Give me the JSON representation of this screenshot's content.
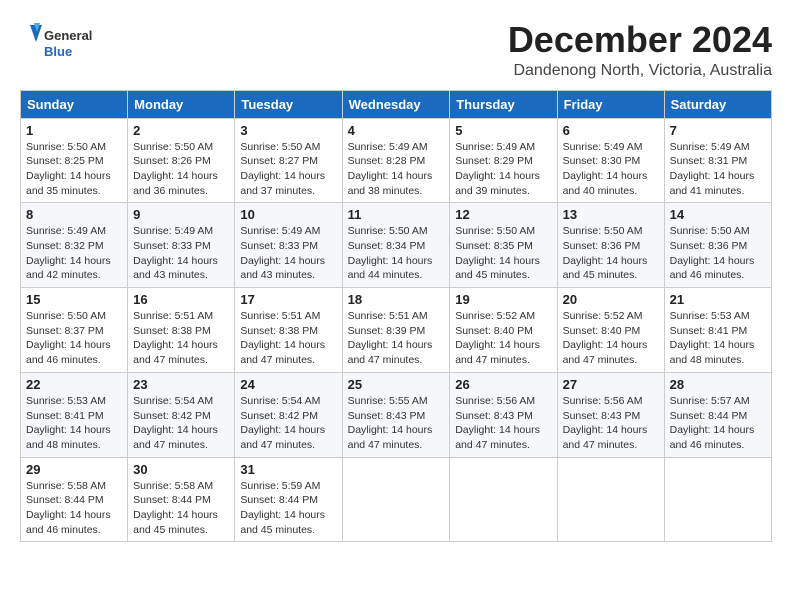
{
  "logo": {
    "general": "General",
    "blue": "Blue"
  },
  "header": {
    "month": "December 2024",
    "location": "Dandenong North, Victoria, Australia"
  },
  "weekdays": [
    "Sunday",
    "Monday",
    "Tuesday",
    "Wednesday",
    "Thursday",
    "Friday",
    "Saturday"
  ],
  "weeks": [
    [
      {
        "day": "1",
        "info": "Sunrise: 5:50 AM\nSunset: 8:25 PM\nDaylight: 14 hours\nand 35 minutes."
      },
      {
        "day": "2",
        "info": "Sunrise: 5:50 AM\nSunset: 8:26 PM\nDaylight: 14 hours\nand 36 minutes."
      },
      {
        "day": "3",
        "info": "Sunrise: 5:50 AM\nSunset: 8:27 PM\nDaylight: 14 hours\nand 37 minutes."
      },
      {
        "day": "4",
        "info": "Sunrise: 5:49 AM\nSunset: 8:28 PM\nDaylight: 14 hours\nand 38 minutes."
      },
      {
        "day": "5",
        "info": "Sunrise: 5:49 AM\nSunset: 8:29 PM\nDaylight: 14 hours\nand 39 minutes."
      },
      {
        "day": "6",
        "info": "Sunrise: 5:49 AM\nSunset: 8:30 PM\nDaylight: 14 hours\nand 40 minutes."
      },
      {
        "day": "7",
        "info": "Sunrise: 5:49 AM\nSunset: 8:31 PM\nDaylight: 14 hours\nand 41 minutes."
      }
    ],
    [
      {
        "day": "8",
        "info": "Sunrise: 5:49 AM\nSunset: 8:32 PM\nDaylight: 14 hours\nand 42 minutes."
      },
      {
        "day": "9",
        "info": "Sunrise: 5:49 AM\nSunset: 8:33 PM\nDaylight: 14 hours\nand 43 minutes."
      },
      {
        "day": "10",
        "info": "Sunrise: 5:49 AM\nSunset: 8:33 PM\nDaylight: 14 hours\nand 43 minutes."
      },
      {
        "day": "11",
        "info": "Sunrise: 5:50 AM\nSunset: 8:34 PM\nDaylight: 14 hours\nand 44 minutes."
      },
      {
        "day": "12",
        "info": "Sunrise: 5:50 AM\nSunset: 8:35 PM\nDaylight: 14 hours\nand 45 minutes."
      },
      {
        "day": "13",
        "info": "Sunrise: 5:50 AM\nSunset: 8:36 PM\nDaylight: 14 hours\nand 45 minutes."
      },
      {
        "day": "14",
        "info": "Sunrise: 5:50 AM\nSunset: 8:36 PM\nDaylight: 14 hours\nand 46 minutes."
      }
    ],
    [
      {
        "day": "15",
        "info": "Sunrise: 5:50 AM\nSunset: 8:37 PM\nDaylight: 14 hours\nand 46 minutes."
      },
      {
        "day": "16",
        "info": "Sunrise: 5:51 AM\nSunset: 8:38 PM\nDaylight: 14 hours\nand 47 minutes."
      },
      {
        "day": "17",
        "info": "Sunrise: 5:51 AM\nSunset: 8:38 PM\nDaylight: 14 hours\nand 47 minutes."
      },
      {
        "day": "18",
        "info": "Sunrise: 5:51 AM\nSunset: 8:39 PM\nDaylight: 14 hours\nand 47 minutes."
      },
      {
        "day": "19",
        "info": "Sunrise: 5:52 AM\nSunset: 8:40 PM\nDaylight: 14 hours\nand 47 minutes."
      },
      {
        "day": "20",
        "info": "Sunrise: 5:52 AM\nSunset: 8:40 PM\nDaylight: 14 hours\nand 47 minutes."
      },
      {
        "day": "21",
        "info": "Sunrise: 5:53 AM\nSunset: 8:41 PM\nDaylight: 14 hours\nand 48 minutes."
      }
    ],
    [
      {
        "day": "22",
        "info": "Sunrise: 5:53 AM\nSunset: 8:41 PM\nDaylight: 14 hours\nand 48 minutes."
      },
      {
        "day": "23",
        "info": "Sunrise: 5:54 AM\nSunset: 8:42 PM\nDaylight: 14 hours\nand 47 minutes."
      },
      {
        "day": "24",
        "info": "Sunrise: 5:54 AM\nSunset: 8:42 PM\nDaylight: 14 hours\nand 47 minutes."
      },
      {
        "day": "25",
        "info": "Sunrise: 5:55 AM\nSunset: 8:43 PM\nDaylight: 14 hours\nand 47 minutes."
      },
      {
        "day": "26",
        "info": "Sunrise: 5:56 AM\nSunset: 8:43 PM\nDaylight: 14 hours\nand 47 minutes."
      },
      {
        "day": "27",
        "info": "Sunrise: 5:56 AM\nSunset: 8:43 PM\nDaylight: 14 hours\nand 47 minutes."
      },
      {
        "day": "28",
        "info": "Sunrise: 5:57 AM\nSunset: 8:44 PM\nDaylight: 14 hours\nand 46 minutes."
      }
    ],
    [
      {
        "day": "29",
        "info": "Sunrise: 5:58 AM\nSunset: 8:44 PM\nDaylight: 14 hours\nand 46 minutes."
      },
      {
        "day": "30",
        "info": "Sunrise: 5:58 AM\nSunset: 8:44 PM\nDaylight: 14 hours\nand 45 minutes."
      },
      {
        "day": "31",
        "info": "Sunrise: 5:59 AM\nSunset: 8:44 PM\nDaylight: 14 hours\nand 45 minutes."
      },
      null,
      null,
      null,
      null
    ]
  ]
}
